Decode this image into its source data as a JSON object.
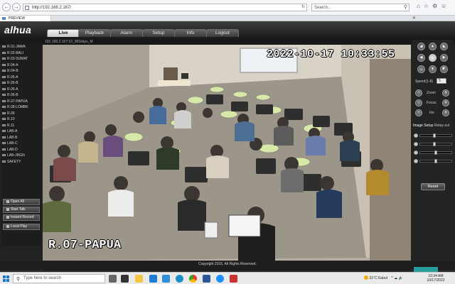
{
  "browser": {
    "url": "http://192.168.2.167/",
    "search_placeholder": "Search...",
    "tab_title": "PREVIEW"
  },
  "header": {
    "logo": "alhua",
    "tabs": [
      {
        "label": "Live",
        "active": true
      },
      {
        "label": "Playback"
      },
      {
        "label": "Alarm"
      },
      {
        "label": "Setup"
      },
      {
        "label": "Info"
      },
      {
        "label": "Logout"
      }
    ]
  },
  "sidebar": {
    "channels": [
      "R.01-JAWA",
      "R.02-BALI",
      "R.03-SUMAT",
      "R.04-A",
      "R.04-B",
      "R.05-A",
      "R.05-B",
      "R.06-A",
      "R.06-B",
      "R.07-PAPUA",
      "R.08-LOMBK",
      "R.09",
      "R.10",
      "R.11",
      "LAB-A",
      "LAB-B",
      "LAB-C",
      "LAB-D",
      "LAB-JRGN",
      "SAFETY"
    ],
    "buttons": {
      "open_all": "Open All",
      "start_talk": "Start Talk",
      "instant_record": "Instant Record",
      "local_play": "Local Play"
    }
  },
  "video": {
    "stream_info": "192.168.2.167:10_981kbps_M",
    "osd_datetime": "2022-10-17  10:33:55",
    "osd_name": "R.07-PAPUA"
  },
  "ptz": {
    "speed_label": "Speed(1-8)",
    "speed_value": "5",
    "zoom": "Zoom",
    "focus": "Focus",
    "iris": "Iris",
    "image_setup": "Image Setup",
    "relay_out": "Relay-out",
    "sliders": [
      0.45,
      0.45,
      0.5,
      0.5
    ],
    "reset": "Reset"
  },
  "footer": {
    "copyright": "Copyright 2015, All Rights Reserved."
  },
  "taskbar": {
    "search_placeholder": "Type here to search",
    "weather": "31°C  Kabut",
    "time": "10:34 AM",
    "date": "10/17/2022"
  },
  "colors": {
    "accent": "#2a9d9d",
    "tab_active": "#e6e6e6"
  }
}
